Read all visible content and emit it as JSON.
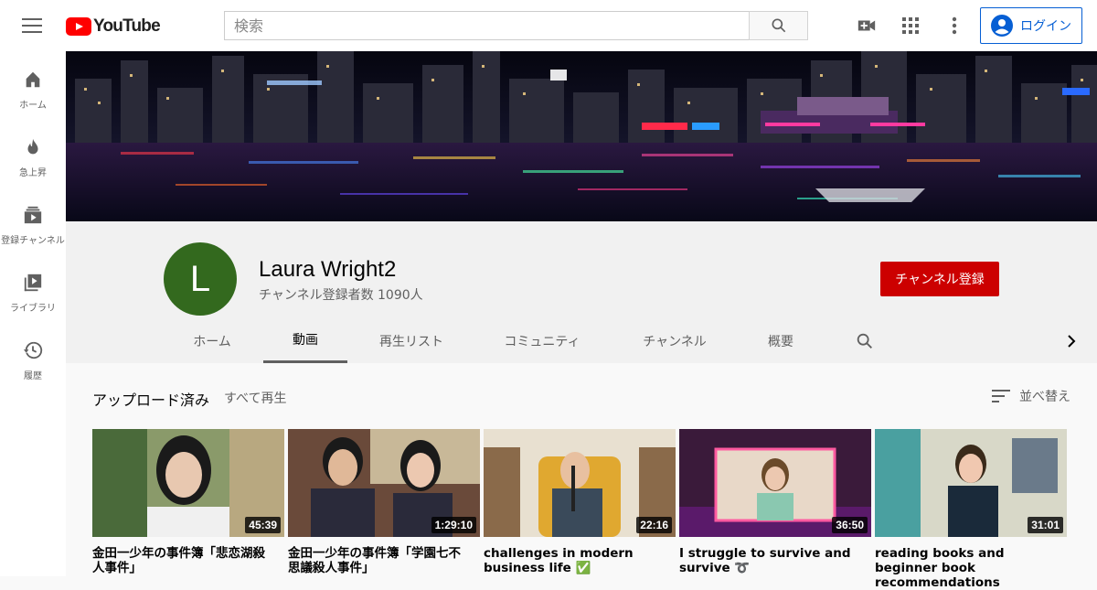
{
  "header": {
    "logo_text": "YouTube",
    "search_placeholder": "検索",
    "login_label": "ログイン"
  },
  "sidebar": {
    "items": [
      {
        "label": "ホーム",
        "icon": "home-icon"
      },
      {
        "label": "急上昇",
        "icon": "fire-icon"
      },
      {
        "label": "登録チャンネル",
        "icon": "subscriptions-icon"
      },
      {
        "label": "ライブラリ",
        "icon": "library-icon"
      },
      {
        "label": "履歴",
        "icon": "history-icon"
      }
    ]
  },
  "channel": {
    "avatar_letter": "L",
    "avatar_color": "#33691e",
    "name": "Laura Wright2",
    "subscribers": "チャンネル登録者数 1090人",
    "subscribe_label": "チャンネル登録",
    "subscribe_color": "#cc0000"
  },
  "tabs": [
    {
      "label": "ホーム"
    },
    {
      "label": "動画",
      "active": true
    },
    {
      "label": "再生リスト"
    },
    {
      "label": "コミュニティ"
    },
    {
      "label": "チャンネル"
    },
    {
      "label": "概要"
    }
  ],
  "section": {
    "title": "アップロード済み",
    "play_all": "すべて再生",
    "sort_label": "並べ替え"
  },
  "videos": [
    {
      "title": "金田一少年の事件簿「悲恋湖殺人事件」",
      "duration": "45:39"
    },
    {
      "title": "金田一少年の事件簿「学園七不思議殺人事件」",
      "duration": "1:29:10"
    },
    {
      "title": "challenges in modern business life ✅",
      "duration": "22:16"
    },
    {
      "title": "I struggle to survive and survive ➰",
      "duration": "36:50"
    },
    {
      "title": "reading books and beginner book recommendations",
      "duration": "31:01"
    }
  ]
}
